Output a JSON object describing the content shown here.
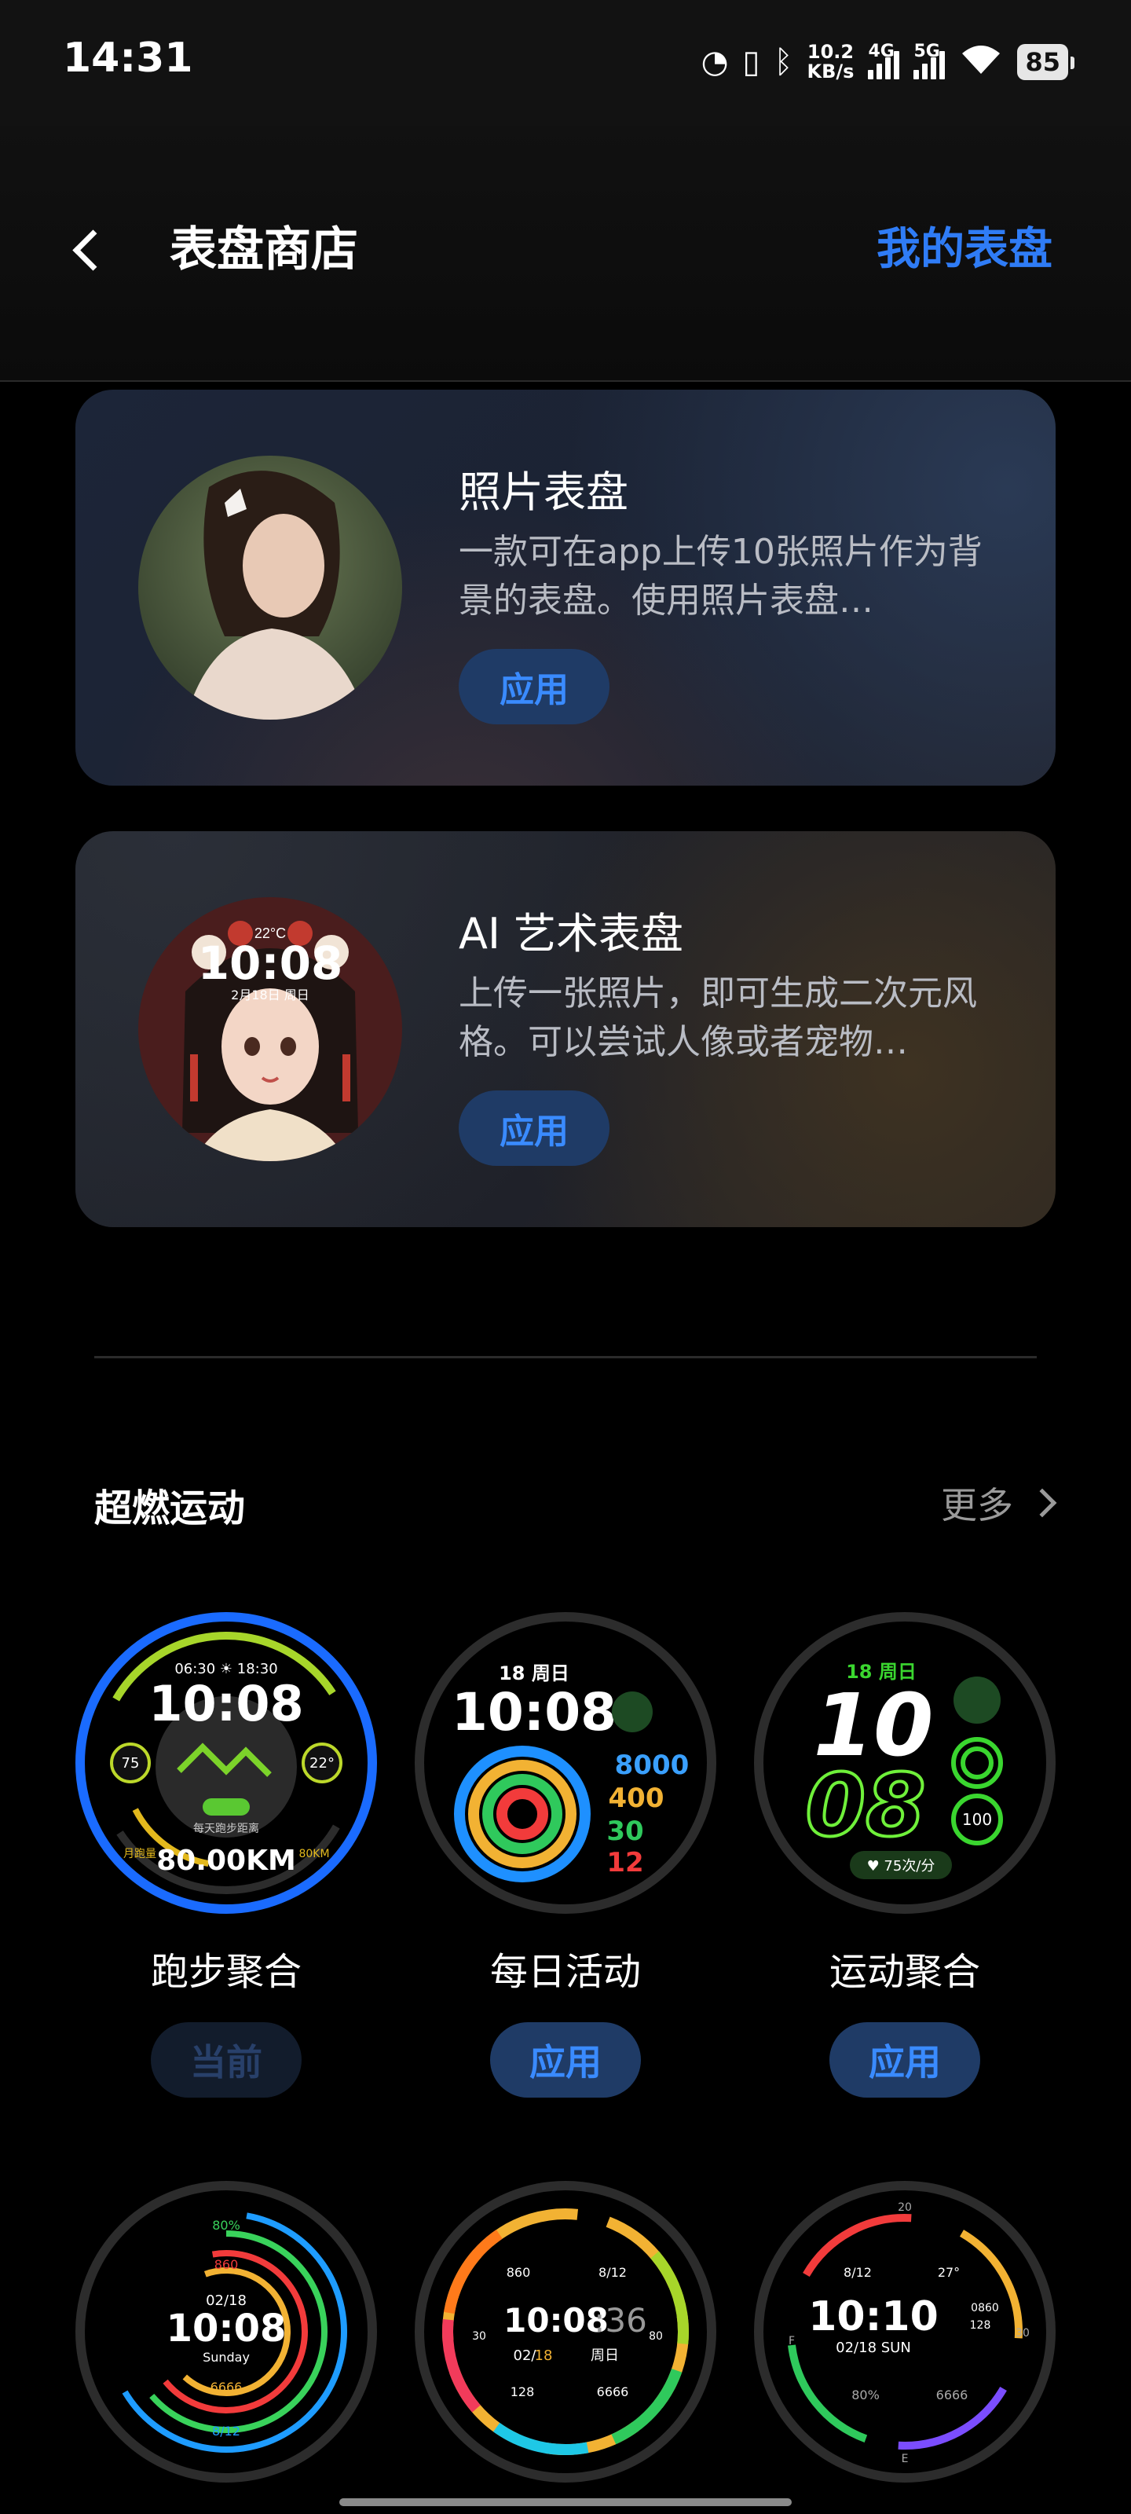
{
  "status_bar": {
    "time": "14:31",
    "net_speed_value": "10.2",
    "net_speed_unit": "KB/s",
    "sig1_label": "4G",
    "sig2_label": "5G",
    "battery": "85"
  },
  "header": {
    "title": "表盘商店",
    "my_faces": "我的表盘"
  },
  "featured": [
    {
      "title": "照片表盘",
      "desc": "一款可在app上传10张照片作为背景的表盘。使用照片表盘…",
      "button": "应用"
    },
    {
      "title": "AI 艺术表盘",
      "desc": "上传一张照片，即可生成二次元风格。可以尝试人像或者宠物…",
      "button": "应用",
      "preview_weather": "22°C",
      "preview_time": "10:08",
      "preview_date": "2月18日 周日"
    }
  ],
  "section": {
    "title": "超燃运动",
    "more": "更多"
  },
  "faces": [
    {
      "name": "跑步聚合",
      "button": "当前",
      "f_sun": "06:30 ☀ 18:30",
      "f_time": "10:08",
      "f_left": "75",
      "f_right": "22°",
      "f_dist": "80.00KM",
      "f_small1": "每天跑步距离",
      "f_small2": "月跑量",
      "f_small3": "80KM"
    },
    {
      "name": "每日活动",
      "button": "应用",
      "f_date": "18 周日",
      "f_time": "10:08",
      "v1": "8000",
      "v2": "400",
      "v3": "30",
      "v4": "12"
    },
    {
      "name": "运动聚合",
      "button": "应用",
      "f_date": "18 周日",
      "h": "10",
      "m": "08",
      "v": "100",
      "hr": "♥ 75次/分"
    },
    {
      "f_top": "80%",
      "f_red": "860",
      "f_date": "02/18",
      "f_time": "10:08",
      "f_day": "Sunday",
      "f_steps": "6666",
      "f_bottom": "8/12"
    },
    {
      "a": "860",
      "b": "8/12",
      "c": "30",
      "d": "80",
      "e": "128",
      "f": "6666",
      "time_hm": "10:08",
      "time_s": ":36",
      "date_a": "02/",
      "date_b": "18",
      "wd": "周日"
    },
    {
      "top": "20",
      "r1": "8/12",
      "r2": "27°",
      "t": "10:10",
      "d": "02/18 SUN",
      "x1": "0860",
      "x2": "128",
      "s1": "80%",
      "s2": "6666",
      "l": "F",
      "r": "30",
      "b": "E"
    }
  ],
  "colors": {
    "accent": "#2f7cf6",
    "button_bg": "#1f3b66"
  }
}
